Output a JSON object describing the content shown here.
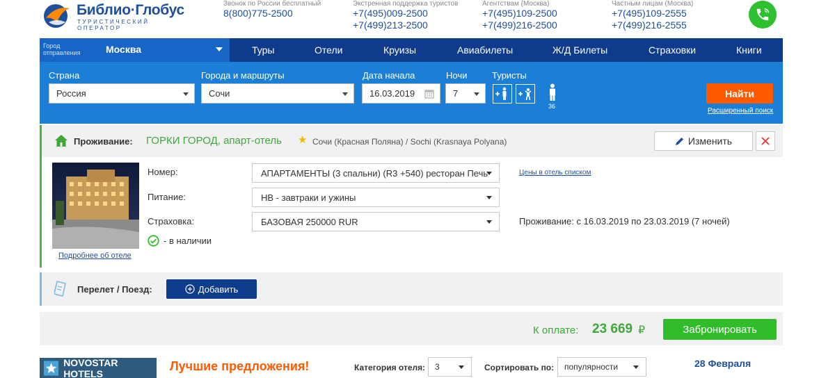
{
  "header": {
    "logo_name": "Библио·Глобус",
    "logo_sub": "ТУРИСТИЧЕСКИЙ ОПЕРАТОР",
    "phones": [
      {
        "label": "Звонок по России бесплатный",
        "numbers": [
          "8(800)775-2500"
        ]
      },
      {
        "label": "Экстренная поддержка туристов",
        "numbers": [
          "+7(495)009-2500",
          "+7(499)213-2500"
        ]
      },
      {
        "label": "Агентствам (Москва)",
        "numbers": [
          "+7(495)109-2500",
          "+7(499)216-2500"
        ]
      },
      {
        "label": "Частным лицам (Москва)",
        "numbers": [
          "+7(495)109-2555",
          "+7(499)216-2555"
        ]
      }
    ]
  },
  "nav": {
    "city_label": "Город отправления",
    "city_value": "Москва",
    "items": [
      "Туры",
      "Отели",
      "Круизы",
      "Авиабилеты",
      "Ж/Д Билеты",
      "Страховки",
      "Книги"
    ]
  },
  "search": {
    "country_label": "Страна",
    "country_value": "Россия",
    "cities_label": "Города и маршруты",
    "cities_value": "Сочи",
    "date_label": "Дата начала",
    "date_value": "16.03.2019",
    "nights_label": "Ночи",
    "nights_value": "7",
    "tourists_label": "Туристы",
    "tourist_age": "36",
    "find_label": "Найти",
    "advanced_label": "Расширенный поиск"
  },
  "accommodation": {
    "title": "Проживание:",
    "hotel_name": "ГОРКИ ГОРОД, апарт-отель",
    "star": "★",
    "location": "Сочи (Красная Поляна) / Sochi (Krasnaya Polyana)",
    "change_label": "Изменить",
    "room_label": "Номер:",
    "room_value": "АПАРТАМЕНТЫ (3 спальни) (R3 +540) ресторан Печь",
    "meal_label": "Питание:",
    "meal_value": "HB - завтраки и ужины",
    "insurance_label": "Страховка:",
    "insurance_value": "БАЗОВАЯ 250000 RUR",
    "availability": "- в наличии",
    "prices_link": "Цены в отель списком",
    "stay_text": "Проживание: с 16.03.2019 по 23.03.2019 (7 ночей)",
    "more_link": "Подробнее об отеле"
  },
  "flight": {
    "title": "Перелет / Поезд:",
    "add_label": "Добавить"
  },
  "total": {
    "pay_label": "К оплате:",
    "pay_value": "23 669",
    "currency": "₽",
    "book_label": "Забронировать"
  },
  "bottom": {
    "brand": "NOVOSTAR HOTELS",
    "best_label": "Лучшие предложения!",
    "category_label": "Категория отеля:",
    "category_value": "3",
    "sort_label": "Сортировать по:",
    "sort_value": "популярности",
    "date": "28 Февраля"
  },
  "colors": {
    "nav_bg": "#0e3b8c",
    "search_bg": "#1b7fd7",
    "accent_orange": "#ff5a00",
    "accent_green": "#2fbe2a",
    "link_blue": "#1f4f9c"
  }
}
